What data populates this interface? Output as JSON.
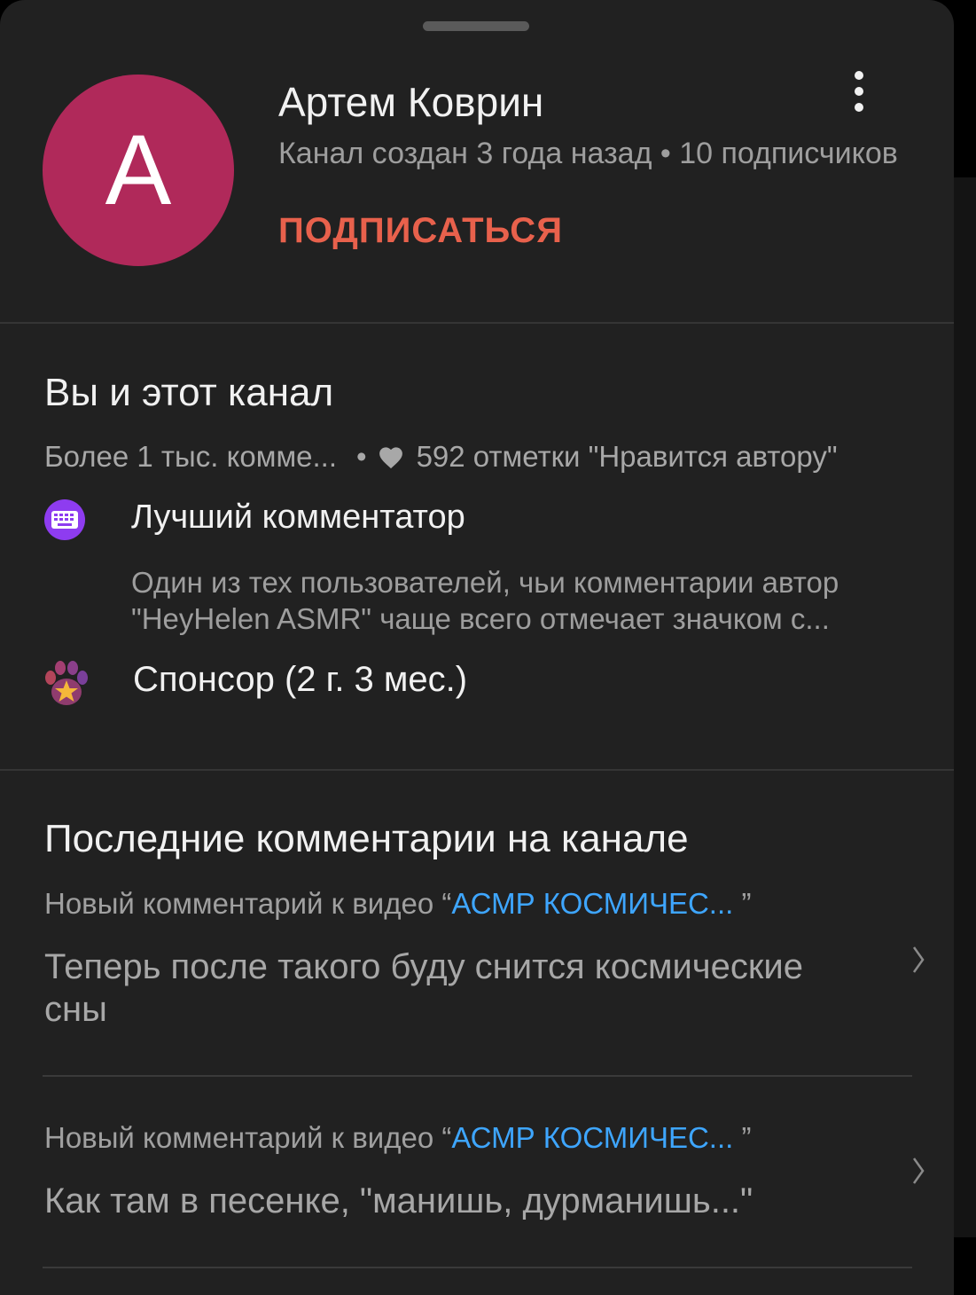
{
  "channel": {
    "avatar_letter": "A",
    "avatar_color": "#b0295a",
    "name": "Артем Коврин",
    "meta": "Канал создан 3 года назад • 10 подписчиков",
    "subscribe_label": "ПОДПИСАТЬСЯ",
    "more_icon": "more-vert-icon"
  },
  "relationship": {
    "title": "Вы и этот канал",
    "comments_count": "Более 1 тыс. комме...",
    "separator": "•",
    "hearts": "592 отметки \"Нравится автору\"",
    "top_commenter": {
      "icon": "keyboard-icon",
      "title": "Лучший комментатор",
      "description_line1": "Один из тех пользователей, чьи комментарии автор",
      "description_line2": "\"HeyHelen ASMR\" чаще всего отмечает значком с..."
    },
    "sponsor": {
      "icon": "paw-star-badge-icon",
      "label": "Спонсор (2 г. 3 мес.)"
    }
  },
  "recent_comments": {
    "title": "Последние комментарии на канале",
    "items": [
      {
        "prefix": "Новый комментарий к видео",
        "open_quote": "“",
        "video_title": "АСМР КОСМИЧЕС...",
        "close_quote": "”",
        "text": "Теперь после такого буду снится космические сны"
      },
      {
        "prefix": "Новый комментарий к видео",
        "open_quote": "“",
        "video_title": "АСМР КОСМИЧЕС...",
        "close_quote": "”",
        "text": "Как там в песенке, \"манишь, дурманишь...\""
      }
    ]
  },
  "colors": {
    "background": "#212121",
    "accent_subscribe": "#e8614c",
    "link": "#3ea6ff",
    "badge_purple": "#8e3cf0"
  }
}
